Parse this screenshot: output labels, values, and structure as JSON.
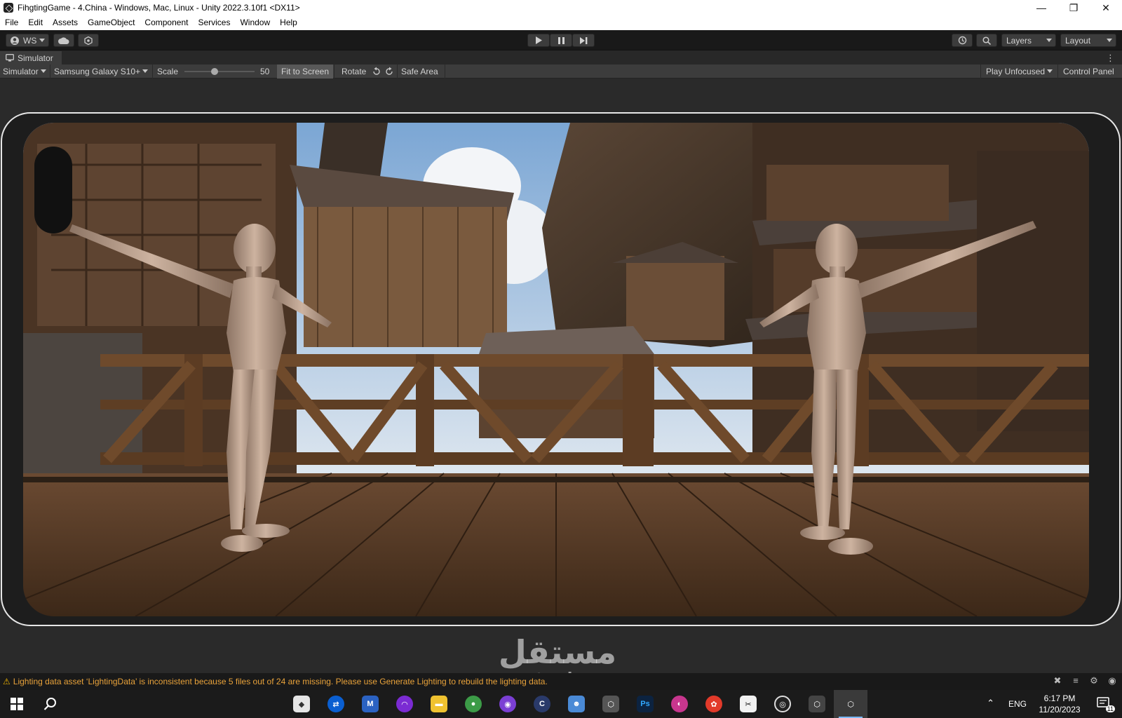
{
  "window": {
    "title": "FihgtingGame - 4.China - Windows, Mac, Linux - Unity 2022.3.10f1 <DX11>",
    "minimize": "—",
    "maximize": "❐",
    "close": "✕"
  },
  "menu": [
    "File",
    "Edit",
    "Assets",
    "GameObject",
    "Component",
    "Services",
    "Window",
    "Help"
  ],
  "toolbar": {
    "account": "WS",
    "layers": "Layers",
    "layout": "Layout"
  },
  "simulator_tab": {
    "title": "Simulator"
  },
  "sim_toolbar": {
    "mode": "Simulator",
    "device": "Samsung Galaxy S10+",
    "scale_label": "Scale",
    "scale_value": "50",
    "scale_fraction": 0.43,
    "fit": "Fit to Screen",
    "rotate": "Rotate",
    "safe_area": "Safe Area",
    "play_mode": "Play Unfocused",
    "control_panel": "Control Panel"
  },
  "status": {
    "message": "Lighting data asset ‘LightingData’ is inconsistent because 5 files out of 24 are missing. Please use Generate Lighting to rebuild the lighting data."
  },
  "taskbar": {
    "language": "ENG",
    "time": "6:17 PM",
    "date": "11/20/2023",
    "notifications": "11"
  },
  "watermark": {
    "arabic": "مستقل",
    "latin": "mostaql.com"
  },
  "colors": {
    "warning": "#e8a23a",
    "taskbar_accent": "#7ab8f5"
  }
}
